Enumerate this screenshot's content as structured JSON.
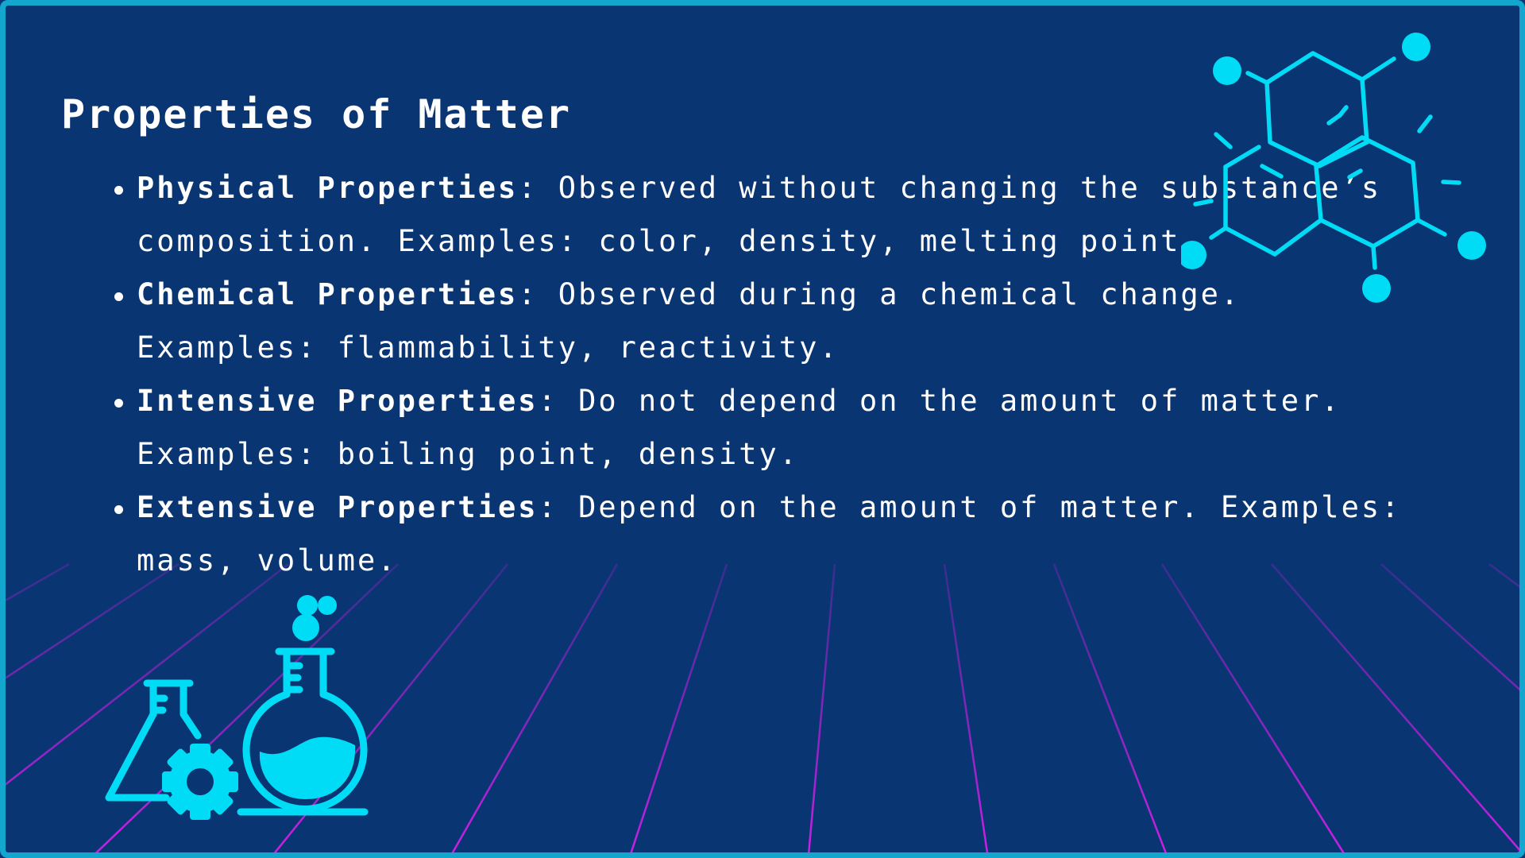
{
  "title": "Properties of Matter",
  "bullets": [
    {
      "term": "Physical Properties",
      "text": ": Observed without changing the substance’s composition. Examples: color, density, melting point."
    },
    {
      "term": "Chemical Properties",
      "text": ": Observed during a chemical change. Examples: flammability, reactivity."
    },
    {
      "term": "Intensive Properties",
      "text": ": Do not depend on the amount of matter. Examples: boiling point, density."
    },
    {
      "term": "Extensive Properties",
      "text": ": Depend on the amount of matter. Examples: mass, volume."
    }
  ],
  "colors": {
    "background": "#0a3573",
    "border": "#13a7d0",
    "accent": "#00dcf5",
    "grid": "#c21be0",
    "text": "#ffffff"
  },
  "icons": [
    "molecule-icon",
    "flask-icon",
    "gear-icon",
    "round-flask-icon"
  ]
}
